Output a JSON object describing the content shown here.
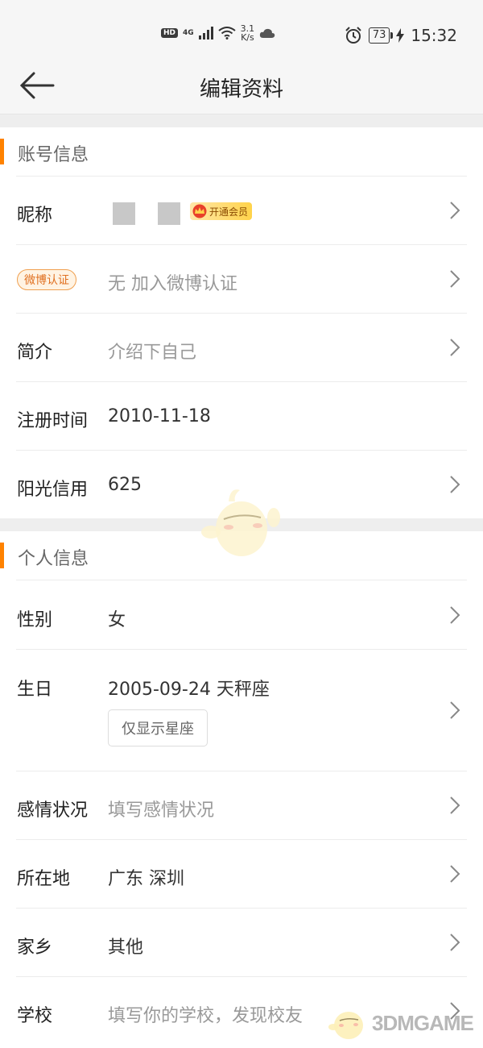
{
  "status_bar": {
    "hd": "HD",
    "network": "4G",
    "speed_top": "3.1",
    "speed_bottom": "K/s",
    "battery": "73",
    "time": "15:32"
  },
  "nav": {
    "title": "编辑资料"
  },
  "account_section": {
    "header": "账号信息",
    "nickname_label": "昵称",
    "vip_badge": "开通会员",
    "verify_tag": "微博认证",
    "verify_value": "无 加入微博认证",
    "bio_label": "简介",
    "bio_placeholder": "介绍下自己",
    "register_label": "注册时间",
    "register_value": "2010-11-18",
    "credit_label": "阳光信用",
    "credit_value": "625"
  },
  "personal_section": {
    "header": "个人信息",
    "gender_label": "性别",
    "gender_value": "女",
    "birthday_label": "生日",
    "birthday_value": "2005-09-24 天秤座",
    "horoscope_button": "仅显示星座",
    "relationship_label": "感情状况",
    "relationship_placeholder": "填写感情状况",
    "location_label": "所在地",
    "location_value": "广东 深圳",
    "hometown_label": "家乡",
    "hometown_value": "其他",
    "school_label": "学校",
    "school_placeholder": "填写你的学校，发现校友"
  },
  "watermark": {
    "text": "3DMGAME"
  },
  "colors": {
    "accent": "#ff8200",
    "background": "#eeeeee"
  }
}
